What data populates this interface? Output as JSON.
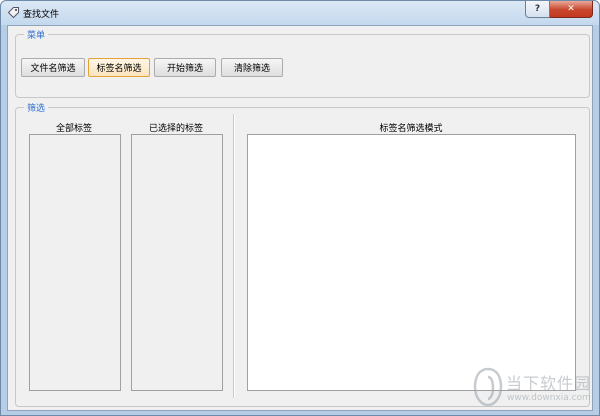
{
  "window": {
    "title": "查找文件",
    "help_label": "?",
    "close_label": "✕"
  },
  "menu": {
    "legend": "菜单",
    "buttons": {
      "filename_filter": "文件名筛选",
      "tagname_filter": "标签名筛选",
      "start_filter": "开始筛选",
      "clear_filter": "清除筛选"
    },
    "active": "tagname_filter"
  },
  "filter": {
    "legend": "筛选",
    "all_tags_label": "全部标签",
    "selected_tags_label": "已选择的标签",
    "pattern_label": "标签名筛选模式",
    "pattern_value": ""
  },
  "watermark": {
    "name": "当下软件园",
    "url": "www.downxia.com"
  },
  "colors": {
    "accent": "#2f6fcf",
    "active_border": "#e5a239"
  }
}
